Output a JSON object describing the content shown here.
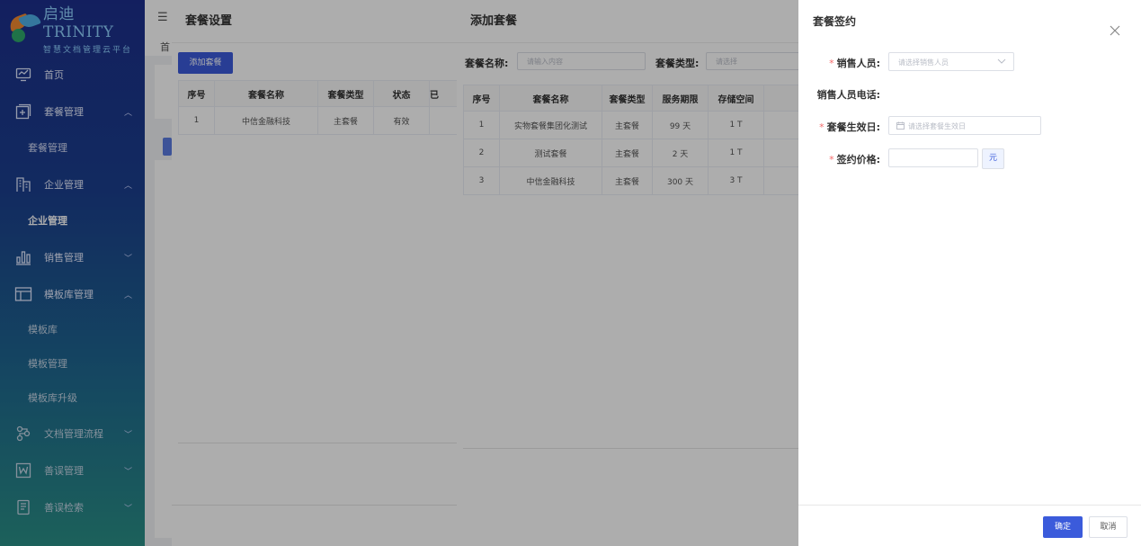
{
  "brand": {
    "name": "启迪 TRINITY",
    "tagline": "智慧文档管理云平台"
  },
  "sidebar": {
    "items": [
      {
        "label": "首页",
        "icon": "monitor-icon"
      },
      {
        "label": "套餐管理",
        "icon": "plus-square-icon",
        "arrow": "^"
      },
      {
        "label": "套餐管理",
        "sub": true
      },
      {
        "label": "企业管理",
        "icon": "building-icon",
        "arrow": "^"
      },
      {
        "label": "企业管理",
        "sub": true,
        "active": true
      },
      {
        "label": "销售管理",
        "icon": "bar-chart-icon",
        "arrow": "v"
      },
      {
        "label": "模板库管理",
        "icon": "layout-icon",
        "arrow": "^"
      },
      {
        "label": "模板库",
        "sub": true
      },
      {
        "label": "模板管理",
        "sub": true
      },
      {
        "label": "模板库升级",
        "sub": true
      },
      {
        "label": "文档管理流程",
        "icon": "flow-icon",
        "arrow": "v"
      },
      {
        "label": "善误管理",
        "icon": "word-icon",
        "arrow": "v"
      },
      {
        "label": "善误检索",
        "icon": "doc-search-icon",
        "arrow": "v"
      }
    ]
  },
  "topbar": {
    "tag_label": "首"
  },
  "panel1": {
    "title": "套餐设置",
    "add_button": "添加套餐",
    "columns": [
      "序号",
      "套餐名称",
      "套餐类型",
      "状态",
      "已"
    ],
    "rows": [
      [
        "1",
        "中信金融科技",
        "主套餐",
        "有效",
        ""
      ]
    ]
  },
  "panel2": {
    "title": "添加套餐",
    "filter_name_label": "套餐名称:",
    "filter_name_placeholder": "请输入内容",
    "filter_type_label": "套餐类型:",
    "filter_type_placeholder": "请选择",
    "columns": [
      "序号",
      "套餐名称",
      "套餐类型",
      "服务期限",
      "存储空间"
    ],
    "rows": [
      [
        "1",
        "实物套餐集团化测试",
        "主套餐",
        "99 天",
        "1 T"
      ],
      [
        "2",
        "测试套餐",
        "主套餐",
        "2 天",
        "1 T"
      ],
      [
        "3",
        "中信金融科技",
        "主套餐",
        "300 天",
        "3 T"
      ]
    ]
  },
  "drawer": {
    "title": "套餐签约",
    "sales_person_label": "销售人员:",
    "sales_person_placeholder": "请选择销售人员",
    "sales_phone_label": "销售人员电话:",
    "effective_date_label": "套餐生效日:",
    "effective_date_placeholder": "请选择套餐生效日",
    "price_label": "签约价格:",
    "price_value": "",
    "price_unit": "元",
    "confirm_button": "确定",
    "cancel_button": "取消"
  },
  "colors": {
    "primary": "#3b5bdb",
    "required": "#f56c6c"
  }
}
